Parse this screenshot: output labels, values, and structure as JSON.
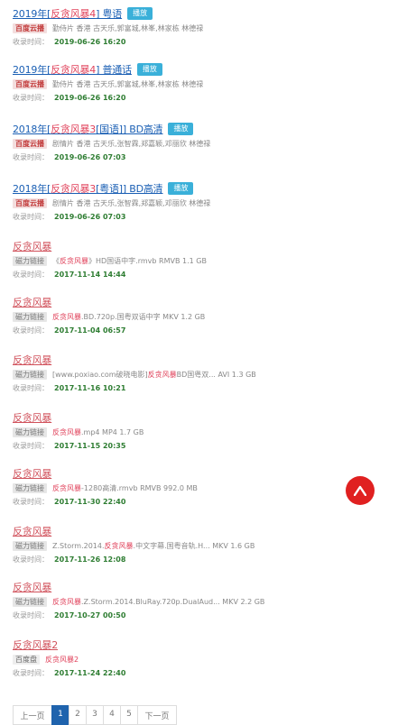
{
  "items": [
    {
      "title_pre": "2019年[",
      "title_hl": "反贪风暴4",
      "title_post": "] 粤语",
      "play": "播放",
      "tag": "百度云播",
      "desc": "勤侍片 香港 古天乐,郭富城,林峯,林家栋 林德禄",
      "time_label": "收录时间：",
      "date": "2019-06-26 16:20"
    },
    {
      "title_pre": "2019年[",
      "title_hl": "反贪风暴4",
      "title_post": "] 普通话",
      "play": "播放",
      "tag": "百度云播",
      "desc": "勤侍片 香港 古天乐,郭富城,林峯,林家栋 林德禄",
      "time_label": "收录时间：",
      "date": "2019-06-26 16:20"
    },
    {
      "title_pre": "2018年[",
      "title_hl": "反贪风暴3",
      "title_post": "[国语]] BD高清",
      "play": "播放",
      "tag": "百度云播",
      "desc": "剧情片 香港 古天乐,张智霖,郑嘉颖,邓丽欣 林德禄",
      "time_label": "收录时间：",
      "date": "2019-06-26 07:03"
    },
    {
      "title_pre": "2018年[",
      "title_hl": "反贪风暴3",
      "title_post": "[粤语]] BD高清",
      "play": "播放",
      "tag": "百度云播",
      "desc": "剧情片 香港 古天乐,张智霖,郑嘉颖,邓丽欣 林德禄",
      "time_label": "收录时间：",
      "date": "2019-06-26 07:03"
    },
    {
      "title": "反贪风暴",
      "tag": "磁力链接",
      "desc_pre": "《",
      "desc_hl": "反贪风暴",
      "desc_post": "》HD国语中字.rmvb RMVB 1.1 GB",
      "time_label": "收录时间：",
      "date": "2017-11-14 14:44"
    },
    {
      "title": "反贪风暴",
      "tag": "磁力链接",
      "desc_pre": "",
      "desc_hl": "反贪风暴",
      "desc_post": ".BD.720p.国粤双语中字 MKV 1.2 GB",
      "time_label": "收录时间：",
      "date": "2017-11-04 06:57"
    },
    {
      "title": "反贪风暴",
      "tag": "磁力链接",
      "desc_pre": "[www.poxiao.com破晓电影]",
      "desc_hl": "反贪风暴",
      "desc_post": "BD国粤双... AVI 1.3 GB",
      "time_label": "收录时间：",
      "date": "2017-11-16 10:21"
    },
    {
      "title": "反贪风暴",
      "tag": "磁力链接",
      "desc_pre": "",
      "desc_hl": "反贪风暴",
      "desc_post": ".mp4 MP4 1.7 GB",
      "time_label": "收录时间：",
      "date": "2017-11-15 20:35"
    },
    {
      "title": "反贪风暴",
      "tag": "磁力链接",
      "desc_pre": "",
      "desc_hl": "反贪风暴",
      "desc_post": "-1280高清.rmvb RMVB 992.0 MB",
      "time_label": "收录时间：",
      "date": "2017-11-30 22:40"
    },
    {
      "title": "反贪风暴",
      "tag": "磁力链接",
      "desc_pre": "Z.Storm.2014.",
      "desc_hl": "反贪风暴",
      "desc_post": ".中文字幕.国粤音轨.H... MKV 1.6 GB",
      "time_label": "收录时间：",
      "date": "2017-11-26 12:08"
    },
    {
      "title": "反贪风暴",
      "tag": "磁力链接",
      "desc_pre": "",
      "desc_hl": "反贪风暴",
      "desc_post": ".Z.Storm.2014.BluRay.720p.DualAud... MKV 2.2 GB",
      "time_label": "收录时间：",
      "date": "2017-10-27 00:50"
    },
    {
      "title": "反贪风暴2",
      "tag": "百度盘",
      "desc_pre": "",
      "desc_hl": "反贪风暴2",
      "desc_post": "",
      "time_label": "收录时间：",
      "date": "2017-11-24 22:40"
    }
  ],
  "pagination": {
    "prev": "上一页",
    "pages": [
      "1",
      "2",
      "3",
      "4",
      "5"
    ],
    "next": "下一页",
    "current": "1"
  },
  "colors": {
    "link": "#1a5fb4",
    "highlight": "#e0415a",
    "date": "#2e7d32",
    "play": "#3ab0d9",
    "up": "#e02020",
    "active_page": "#1f63ad"
  }
}
